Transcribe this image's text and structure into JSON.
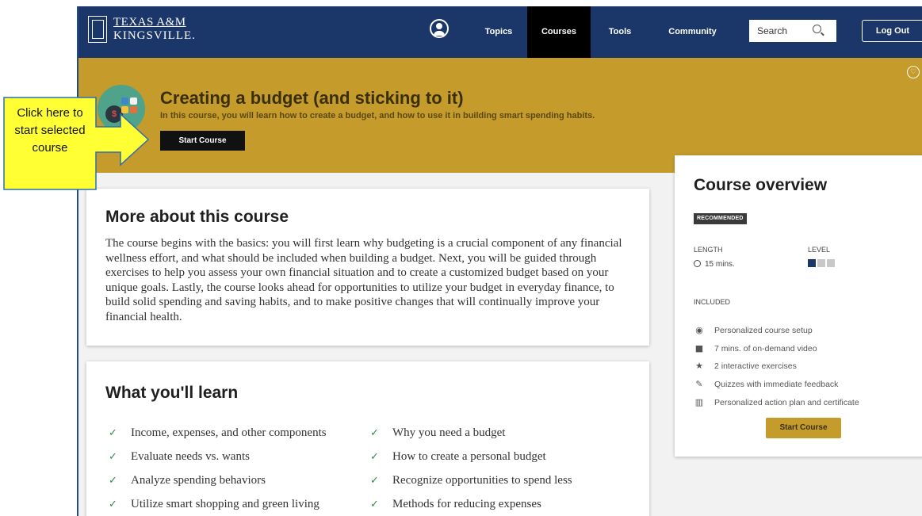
{
  "nav": {
    "logo_line1": "TEXAS A&M",
    "logo_line2": "KINGSVILLE.",
    "links": [
      "Topics",
      "Courses",
      "Tools",
      "Community"
    ],
    "search_placeholder": "Search",
    "logout_label": "Log Out",
    "active_link": "Courses"
  },
  "hero": {
    "title": "Creating a budget (and sticking to it)",
    "description": "In this course, you will learn how to create a budget, and how to use it in building smart spending habits.",
    "start_label": "Start Course",
    "icon": "money-bag-grid-icon"
  },
  "callout": {
    "text": "Click here to start selected course"
  },
  "about": {
    "heading": "More about this course",
    "body": "The course begins with the basics: you will first learn why budgeting is a crucial component of any financial wellness effort, and what should be included when building a budget. Next, you will be guided through exercises to help you assess your own financial situation and to create a customized budget based on your unique goals. Lastly, the course looks ahead for opportunities to utilize your budget in everyday finance, to build solid spending and saving habits, and to make positive changes that will continually improve your financial health."
  },
  "learn": {
    "heading": "What you'll learn",
    "items": [
      "Income, expenses, and other components",
      "Why you need a budget",
      "Evaluate needs vs. wants",
      "How to create a personal budget",
      "Analyze spending behaviors",
      "Recognize opportunities to spend less",
      "Utilize smart shopping and green living",
      "Methods for reducing expenses"
    ]
  },
  "overview": {
    "title": "Course overview",
    "badge": "RECOMMENDED",
    "length_label": "LENGTH",
    "length_value": "15 mins.",
    "level_label": "LEVEL",
    "level": 1,
    "level_max": 3,
    "included_label": "INCLUDED",
    "included": [
      {
        "icon": "fingerprint-icon",
        "text": "Personalized course setup"
      },
      {
        "icon": "video-camera-icon",
        "text": "7 mins. of on-demand video"
      },
      {
        "icon": "star-icon",
        "text": "2 interactive exercises"
      },
      {
        "icon": "pencil-icon",
        "text": "Quizzes with immediate feedback"
      },
      {
        "icon": "bar-chart-icon",
        "text": "Personalized action plan and certificate"
      }
    ],
    "start_label": "Start Course"
  },
  "colors": {
    "nav": "#1b3769",
    "hero": "#c59b2b",
    "callout_fill": "#ffff33",
    "callout_border": "#2e6db4"
  }
}
